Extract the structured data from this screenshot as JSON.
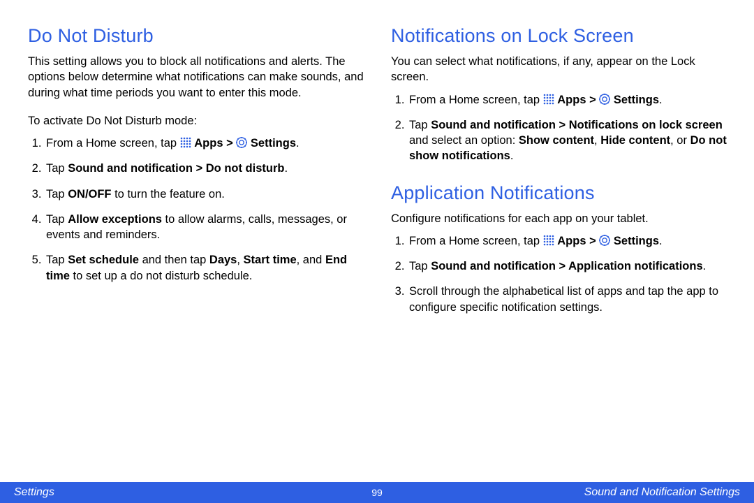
{
  "colors": {
    "accent": "#2e5fe2"
  },
  "icons": {
    "apps": "apps-icon",
    "settings": "settings-icon",
    "arrow": ">"
  },
  "left": {
    "title": "Do Not Disturb",
    "intro": "This setting allows you to block all notifications and alerts. The options below determine what notifications can make sounds, and during what time periods you want to enter this mode.",
    "howto_lead": "To activate Do Not Disturb mode:",
    "steps": {
      "s1_pre": "From a Home screen, tap ",
      "s1_apps": "Apps",
      "s1_settings": "Settings",
      "s2_pre": "Tap ",
      "s2_bold": "Sound and notification",
      "s2_arrow": " > ",
      "s2_bold2": "Do not disturb",
      "s3_pre": "Tap ",
      "s3_bold": "ON/OFF",
      "s3_post": " to turn the feature on.",
      "s4_pre": "Tap ",
      "s4_bold": "Allow exceptions",
      "s4_post": " to allow alarms, calls, messages, or events and reminders.",
      "s5_pre": "Tap ",
      "s5_b1": "Set schedule",
      "s5_mid1": " and then tap ",
      "s5_b2": "Days",
      "s5_c1": ", ",
      "s5_b3": "Start time",
      "s5_c2": ", and ",
      "s5_b4": "End time",
      "s5_post": " to set up a do not disturb schedule."
    }
  },
  "right_top": {
    "title": "Notifications on Lock Screen",
    "intro": "You can select what notifications, if any, appear on the Lock screen.",
    "steps": {
      "s1_pre": "From a Home screen, tap ",
      "s1_apps": "Apps",
      "s1_settings": "Settings",
      "s2_pre": "Tap ",
      "s2_b1": "Sound and notification",
      "s2_arrow": " > ",
      "s2_b2": "Notifications on lock screen",
      "s2_mid": " and select an option: ",
      "s2_b3": "Show content",
      "s2_c1": ", ",
      "s2_b4": "Hide content",
      "s2_c2": ", or ",
      "s2_b5": "Do not show notifications",
      "s2_end": "."
    }
  },
  "right_bot": {
    "title": "Application Notifications",
    "intro": "Configure notifications for each app on your tablet.",
    "steps": {
      "s1_pre": "From a Home screen, tap ",
      "s1_apps": "Apps",
      "s1_settings": "Settings",
      "s2_pre": "Tap ",
      "s2_b1": "Sound and notification",
      "s2_arrow": " > ",
      "s2_b2": "Application notifications",
      "s2_end": ".",
      "s3": "Scroll through the alphabetical list of apps and tap the app to configure specific notification settings."
    }
  },
  "footer": {
    "left": "Settings",
    "page": "99",
    "right": "Sound and Notification Settings"
  }
}
